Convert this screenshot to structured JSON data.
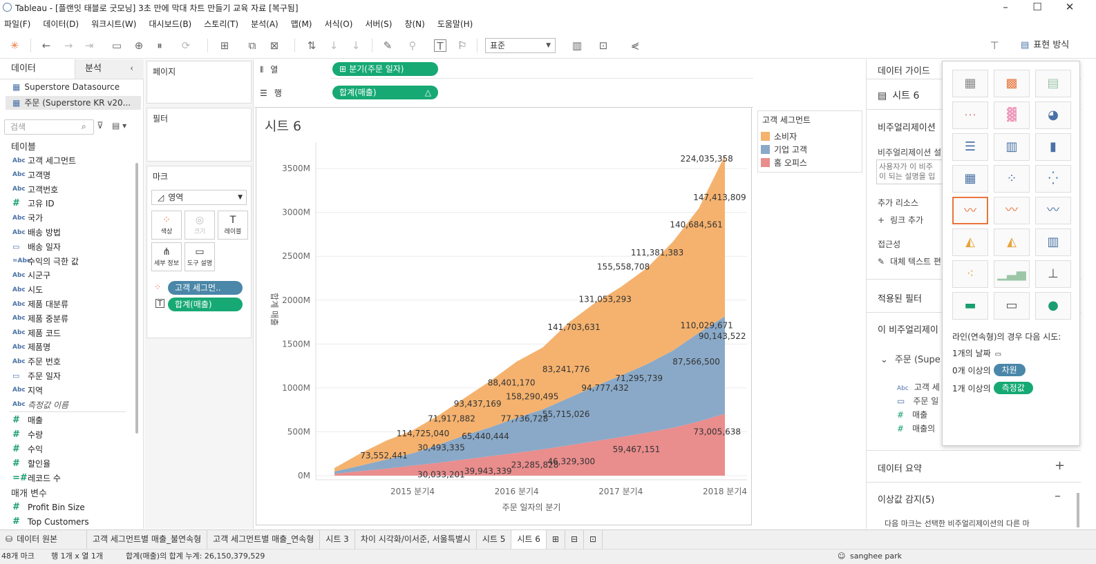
{
  "window": {
    "title": "Tableau - [플랜잇 태블로 굿모닝] 3초 만에 막대 차트 만들기 교육 자료 [복구됨]"
  },
  "menu": [
    "파일(F)",
    "데이터(D)",
    "워크시트(W)",
    "대시보드(B)",
    "스토리(T)",
    "분석(A)",
    "맵(M)",
    "서식(O)",
    "서버(S)",
    "창(N)",
    "도움말(H)"
  ],
  "toolbar": {
    "fit": "표준",
    "show_me": "표현 방식"
  },
  "left": {
    "tab_data": "데이터",
    "tab_analysis": "분석",
    "datasources": [
      "Superstore Datasource",
      "주문 (Superstore KR v20..."
    ],
    "search_placeholder": "검색",
    "tables_header": "테이블",
    "fields": [
      {
        "type": "Abc",
        "name": "고객 세그먼트"
      },
      {
        "type": "Abc",
        "name": "고객명"
      },
      {
        "type": "Abc",
        "name": "고객번호"
      },
      {
        "type": "#",
        "name": "고유 ID"
      },
      {
        "type": "Abc",
        "name": "국가"
      },
      {
        "type": "Abc",
        "name": "배송 방법"
      },
      {
        "type": "date",
        "name": "배송 일자"
      },
      {
        "type": "=Abc",
        "name": "수익의 극한 값"
      },
      {
        "type": "Abc",
        "name": "시군구"
      },
      {
        "type": "Abc",
        "name": "시도"
      },
      {
        "type": "Abc",
        "name": "제품 대분류"
      },
      {
        "type": "Abc",
        "name": "제품 중분류"
      },
      {
        "type": "Abc",
        "name": "제품 코드"
      },
      {
        "type": "Abc",
        "name": "제품명"
      },
      {
        "type": "Abc",
        "name": "주문 번호"
      },
      {
        "type": "date",
        "name": "주문 일자"
      },
      {
        "type": "Abc",
        "name": "지역"
      },
      {
        "type": "Abc",
        "name": "측정값 이름"
      },
      {
        "type": "#",
        "name": "매출"
      },
      {
        "type": "#",
        "name": "수량"
      },
      {
        "type": "#",
        "name": "수익"
      },
      {
        "type": "#",
        "name": "할인율"
      },
      {
        "type": "=#",
        "name": "레코드 수"
      }
    ],
    "params_header": "매개 변수",
    "params": [
      "Profit Bin Size",
      "Top Customers"
    ]
  },
  "cards": {
    "pages": "페이지",
    "filters": "필터",
    "marks": "마크",
    "mark_type": "영역",
    "buttons": [
      "색상",
      "크기",
      "레이블",
      "세부 정보",
      "도구 설명"
    ],
    "pills": [
      "고객 세그먼..",
      "합계(매출)"
    ]
  },
  "shelves": {
    "columns_label": "열",
    "rows_label": "행",
    "columns_pill": "분기(주문 일자)",
    "rows_pill": "합계(매출)"
  },
  "sheet_title": "시트 6",
  "legend": {
    "title": "고객 세그먼트",
    "items": [
      {
        "name": "소비자",
        "color": "#f5b26e"
      },
      {
        "name": "기업 고객",
        "color": "#8aa9c8"
      },
      {
        "name": "홈 오피스",
        "color": "#ea8d8d"
      }
    ]
  },
  "chart_data": {
    "type": "area",
    "stacked": true,
    "xlabel": "주문 일자의 분기",
    "ylabel": "합계 매출",
    "x_ticks": [
      "2015 분기4",
      "2016 분기4",
      "2017 분기4",
      "2018 분기4"
    ],
    "y_ticks": [
      "0M",
      "500M",
      "1000M",
      "1500M",
      "2000M",
      "2500M",
      "3000M",
      "3500M"
    ],
    "ylim": [
      0,
      3800
    ],
    "unit": "M",
    "x_quarters": [
      "2015 Q1",
      "2015 Q2",
      "2015 Q3",
      "2015 Q4",
      "2016 Q1",
      "2016 Q2",
      "2016 Q3",
      "2016 Q4",
      "2017 Q1",
      "2017 Q2",
      "2017 Q3",
      "2017 Q4",
      "2018 Q1",
      "2018 Q2",
      "2018 Q3",
      "2018 Q4"
    ],
    "series": [
      {
        "name": "홈 오피스",
        "color": "#ea8d8d",
        "values": [
          22,
          52,
          80,
          115,
          147,
          185,
          222,
          260,
          300,
          345,
          392,
          440,
          490,
          545,
          618,
          705
        ]
      },
      {
        "name": "기업 고객",
        "color": "#8aa9c8",
        "values": [
          25,
          62,
          105,
          140,
          205,
          275,
          330,
          400,
          455,
          540,
          625,
          700,
          780,
          880,
          1010,
          1110
        ]
      },
      {
        "name": "소비자",
        "color": "#f5b26e",
        "values": [
          40,
          140,
          215,
          260,
          335,
          425,
          530,
          640,
          705,
          860,
          950,
          1010,
          1095,
          1240,
          1420,
          1835
        ]
      }
    ],
    "data_labels": [
      {
        "text": "73,552,441",
        "x": 1.9,
        "y": 230
      },
      {
        "text": "114,725,040",
        "x": 3.4,
        "y": 480
      },
      {
        "text": "71,917,882",
        "x": 4.5,
        "y": 650
      },
      {
        "text": "93,437,169",
        "x": 5.5,
        "y": 820
      },
      {
        "text": "88,401,170",
        "x": 6.8,
        "y": 1060
      },
      {
        "text": "158,290,495",
        "x": 7.6,
        "y": 900
      },
      {
        "text": "83,241,776",
        "x": 8.9,
        "y": 1210
      },
      {
        "text": "141,703,631",
        "x": 9.2,
        "y": 1690
      },
      {
        "text": "131,053,293",
        "x": 10.4,
        "y": 2010
      },
      {
        "text": "155,558,708",
        "x": 11.1,
        "y": 2380
      },
      {
        "text": "111,381,383",
        "x": 12.4,
        "y": 2540
      },
      {
        "text": "140,684,561",
        "x": 13.9,
        "y": 2860
      },
      {
        "text": "147,413,809",
        "x": 14.8,
        "y": 3170
      },
      {
        "text": "224,035,358",
        "x": 14.3,
        "y": 3610
      },
      {
        "text": "30,493,335",
        "x": 4.1,
        "y": 320
      },
      {
        "text": "65,440,444",
        "x": 5.8,
        "y": 450
      },
      {
        "text": "77,736,728",
        "x": 7.3,
        "y": 650
      },
      {
        "text": "55,715,026",
        "x": 8.9,
        "y": 700
      },
      {
        "text": "94,777,432",
        "x": 10.4,
        "y": 1000
      },
      {
        "text": "71,295,739",
        "x": 11.7,
        "y": 1110
      },
      {
        "text": "87,566,500",
        "x": 13.9,
        "y": 1300
      },
      {
        "text": "90,143,522",
        "x": 14.9,
        "y": 1590
      },
      {
        "text": "110,029,671",
        "x": 14.3,
        "y": 1710
      },
      {
        "text": "30,033,201",
        "x": 4.1,
        "y": 10
      },
      {
        "text": "39,943,339",
        "x": 5.9,
        "y": 50
      },
      {
        "text": "23,285,828",
        "x": 7.7,
        "y": 120
      },
      {
        "text": "46,329,300",
        "x": 9.1,
        "y": 160
      },
      {
        "text": "59,467,151",
        "x": 11.6,
        "y": 300
      },
      {
        "text": "73,005,638",
        "x": 14.7,
        "y": 500
      }
    ]
  },
  "right": {
    "header": "데이터 가이드",
    "sheet": "시트 6",
    "viz_desc_header": "비주얼리제이션",
    "viz_desc_sub": "비주얼리제이션 설",
    "viz_desc_text1": "사용자가 이 비주",
    "viz_desc_text2": "이 되는 설명을 입",
    "resources": "추가 리소스",
    "add_link": "링크 추가",
    "accessibility": "접근성",
    "alt_text": "대체 텍스트 편",
    "applied_filters": "적용된 필터",
    "this_viz": "이 비주얼리제이",
    "source": "주문 (Supe",
    "sf1": "고객 세",
    "sf2": "주문 일",
    "sf3": "매출",
    "sf4": "매출의",
    "data_summary": "데이터 요약",
    "outliers": "이상값 감지(5)",
    "outlier_text": "다음 마크는 선택한 비주얼리제이션의 다른 마"
  },
  "showme": {
    "hint": "라인(연속형)의 경우 다음 시도:",
    "req1": "1개의 날짜",
    "req2_prefix": "0개 이상의",
    "req2_pill": "차원",
    "req3_prefix": "1개 이상의",
    "req3_pill": "측정값"
  },
  "tabs": [
    "데이터 원본",
    "고객 세그먼트별 매출_불연속형",
    "고객 세그먼트별 매출_연속형",
    "시트 3",
    "차이 시각화/이서준, 서울특별시",
    "시트 5",
    "시트 6"
  ],
  "status": {
    "marks": "48개 마크",
    "rows_cols": "행 1개 x 열 1개",
    "sum": "합계(매출)의 합계 누계: 26,150,379,529",
    "user": "sanghee park"
  }
}
